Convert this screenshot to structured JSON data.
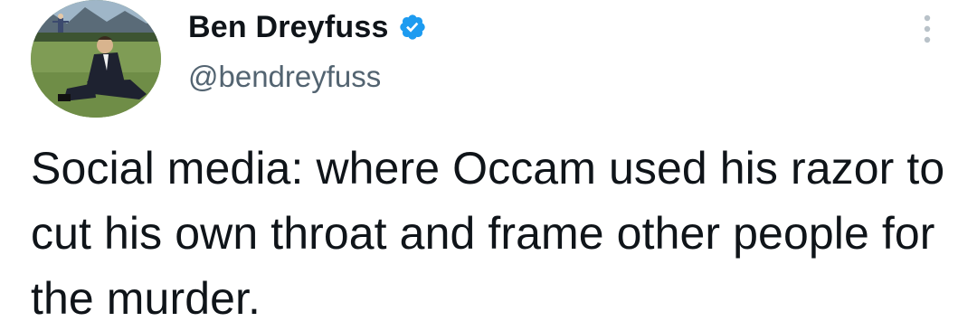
{
  "tweet": {
    "author": {
      "display_name": "Ben Dreyfuss",
      "handle": "@bendreyfuss",
      "verified": true,
      "avatar_icon": "profile-photo-man-in-meadow"
    },
    "text": "Social media: where Occam used his razor to cut his own throat and frame other people for the murder.",
    "more_icon": "vertical-ellipsis",
    "colors": {
      "verified_badge": "#1d9bf0",
      "handle": "#536471",
      "text": "#0f1419"
    }
  }
}
